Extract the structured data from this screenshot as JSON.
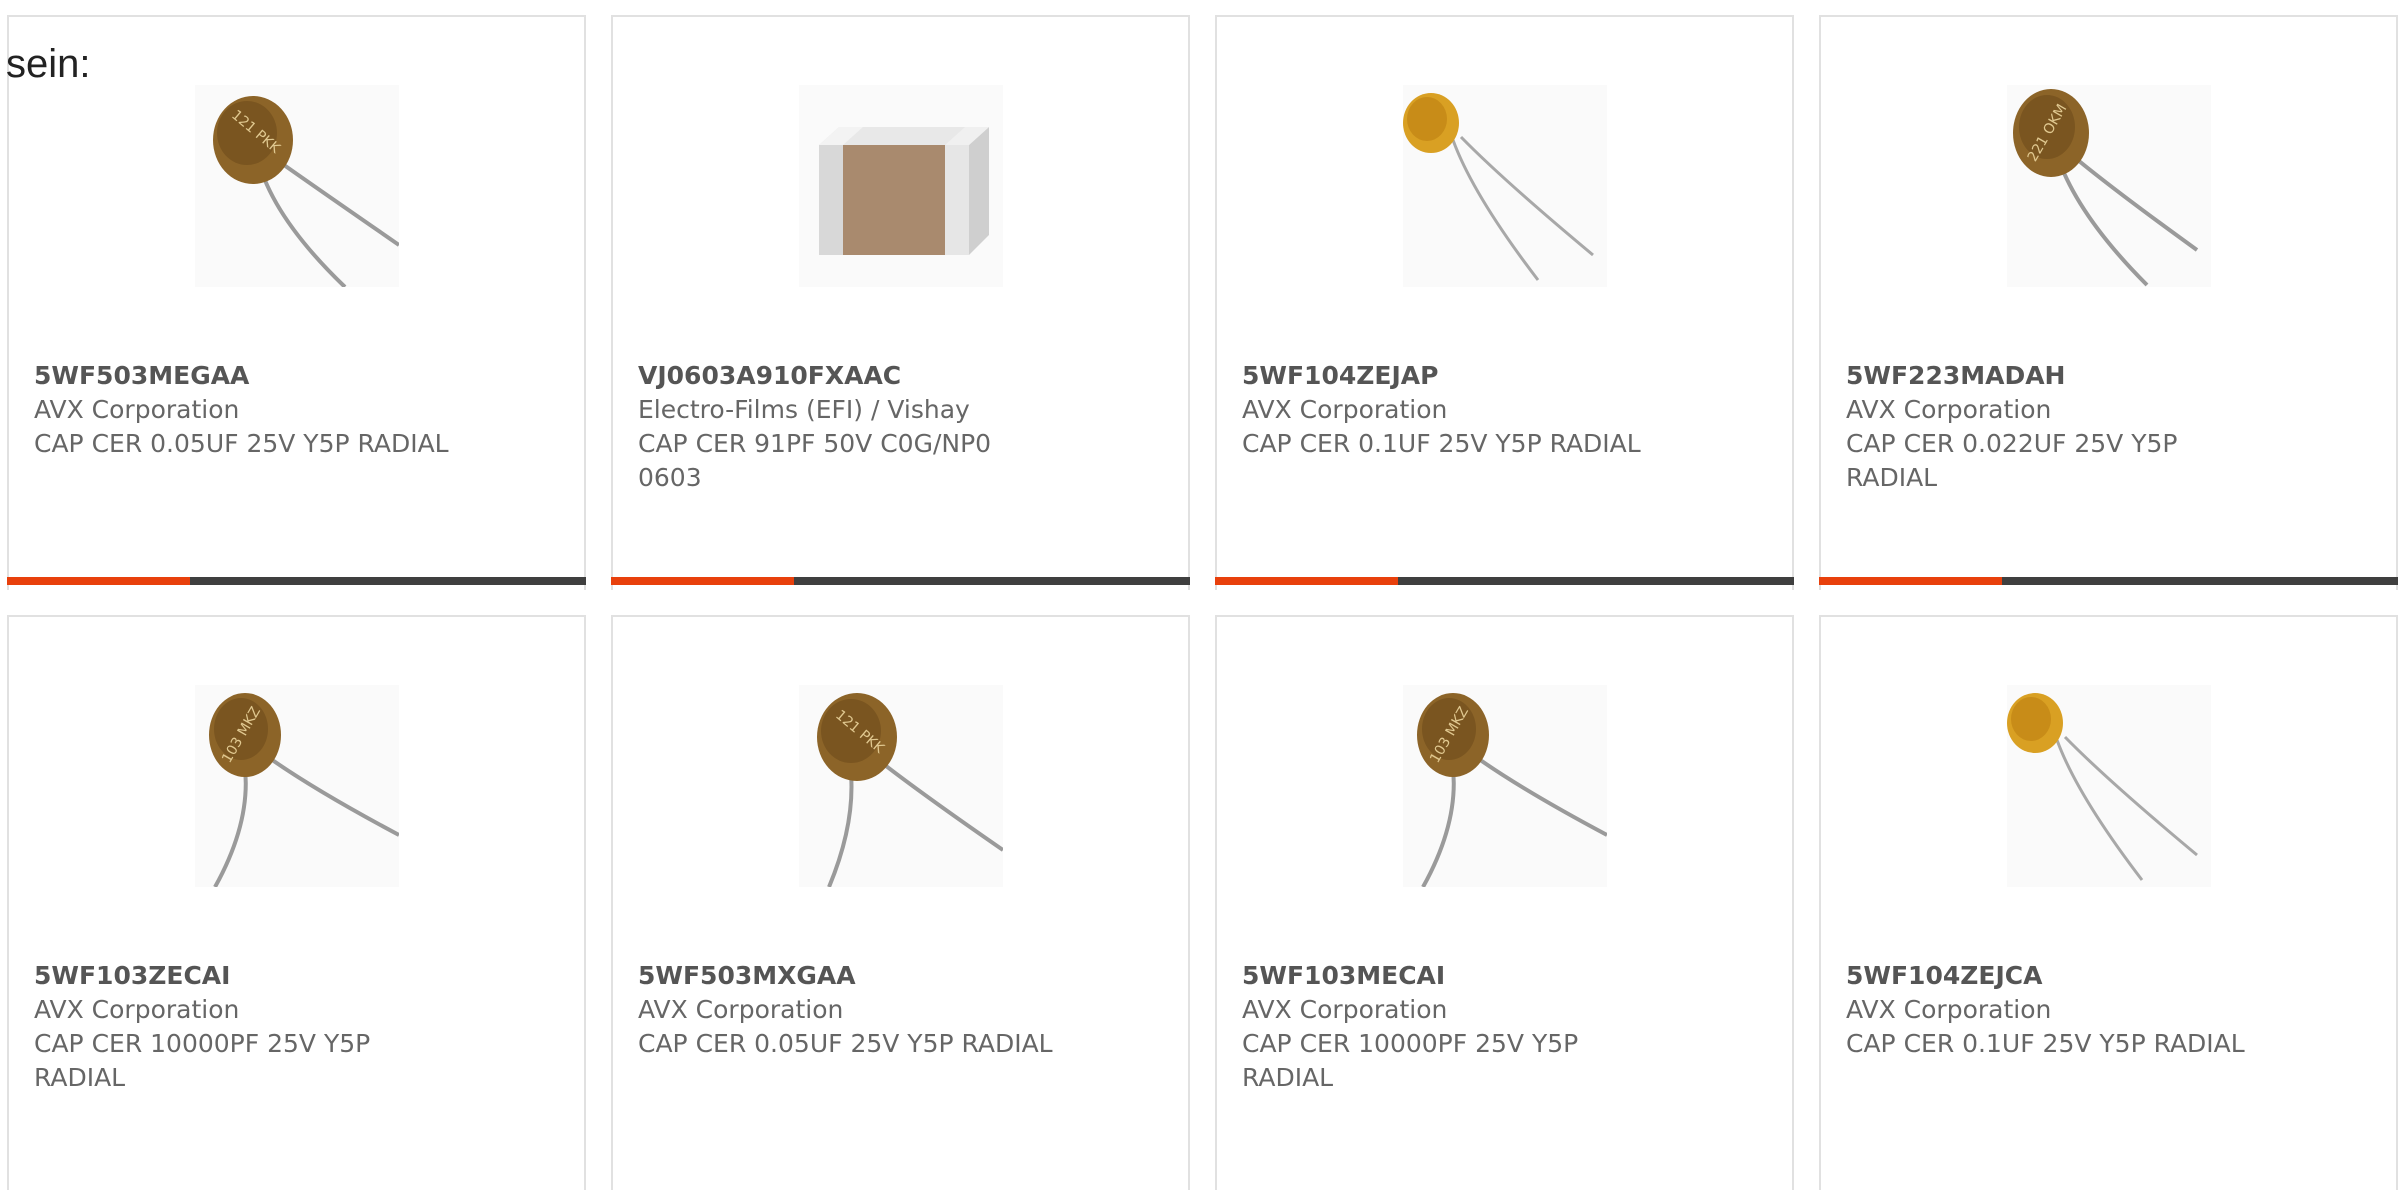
{
  "intro_text": "sein:",
  "colors": {
    "accent": "#e8400c",
    "bar": "#3f3f3f",
    "card_border": "#e1e1e1",
    "part_text": "#555555",
    "body_text": "#666666"
  },
  "products": [
    {
      "part": "5WF503MEGAA",
      "manufacturer": "AVX Corporation",
      "description": "CAP CER 0.05UF 25V Y5P RADIAL",
      "image": "brown-disc-capacitor-icon",
      "marking": "121 PKK"
    },
    {
      "part": "VJ0603A910FXAAC",
      "manufacturer": "Electro-Films (EFI) / Vishay",
      "description": "CAP CER 91PF 50V C0G/NP0 0603",
      "image": "smd-chip-capacitor-icon",
      "marking": ""
    },
    {
      "part": "5WF104ZEJAP",
      "manufacturer": "AVX Corporation",
      "description": "CAP CER 0.1UF 25V Y5P RADIAL",
      "image": "yellow-disc-capacitor-icon",
      "marking": ""
    },
    {
      "part": "5WF223MADAH",
      "manufacturer": "AVX Corporation",
      "description": "CAP CER 0.022UF 25V Y5P RADIAL",
      "image": "brown-disc-capacitor-icon",
      "marking": "221 OKM"
    },
    {
      "part": "5WF103ZECAI",
      "manufacturer": "AVX Corporation",
      "description": "CAP CER 10000PF 25V Y5P RADIAL",
      "image": "brown-disc-capacitor-icon",
      "marking": "103 MKZ"
    },
    {
      "part": "5WF503MXGAA",
      "manufacturer": "AVX Corporation",
      "description": "CAP CER 0.05UF 25V Y5P RADIAL",
      "image": "brown-disc-capacitor-icon",
      "marking": "121 PKK"
    },
    {
      "part": "5WF103MECAI",
      "manufacturer": "AVX Corporation",
      "description": "CAP CER 10000PF 25V Y5P RADIAL",
      "image": "brown-disc-capacitor-icon",
      "marking": "103 MKZ"
    },
    {
      "part": "5WF104ZEJCA",
      "manufacturer": "AVX Corporation",
      "description": "CAP CER 0.1UF 25V Y5P RADIAL",
      "image": "yellow-disc-capacitor-icon",
      "marking": ""
    }
  ]
}
